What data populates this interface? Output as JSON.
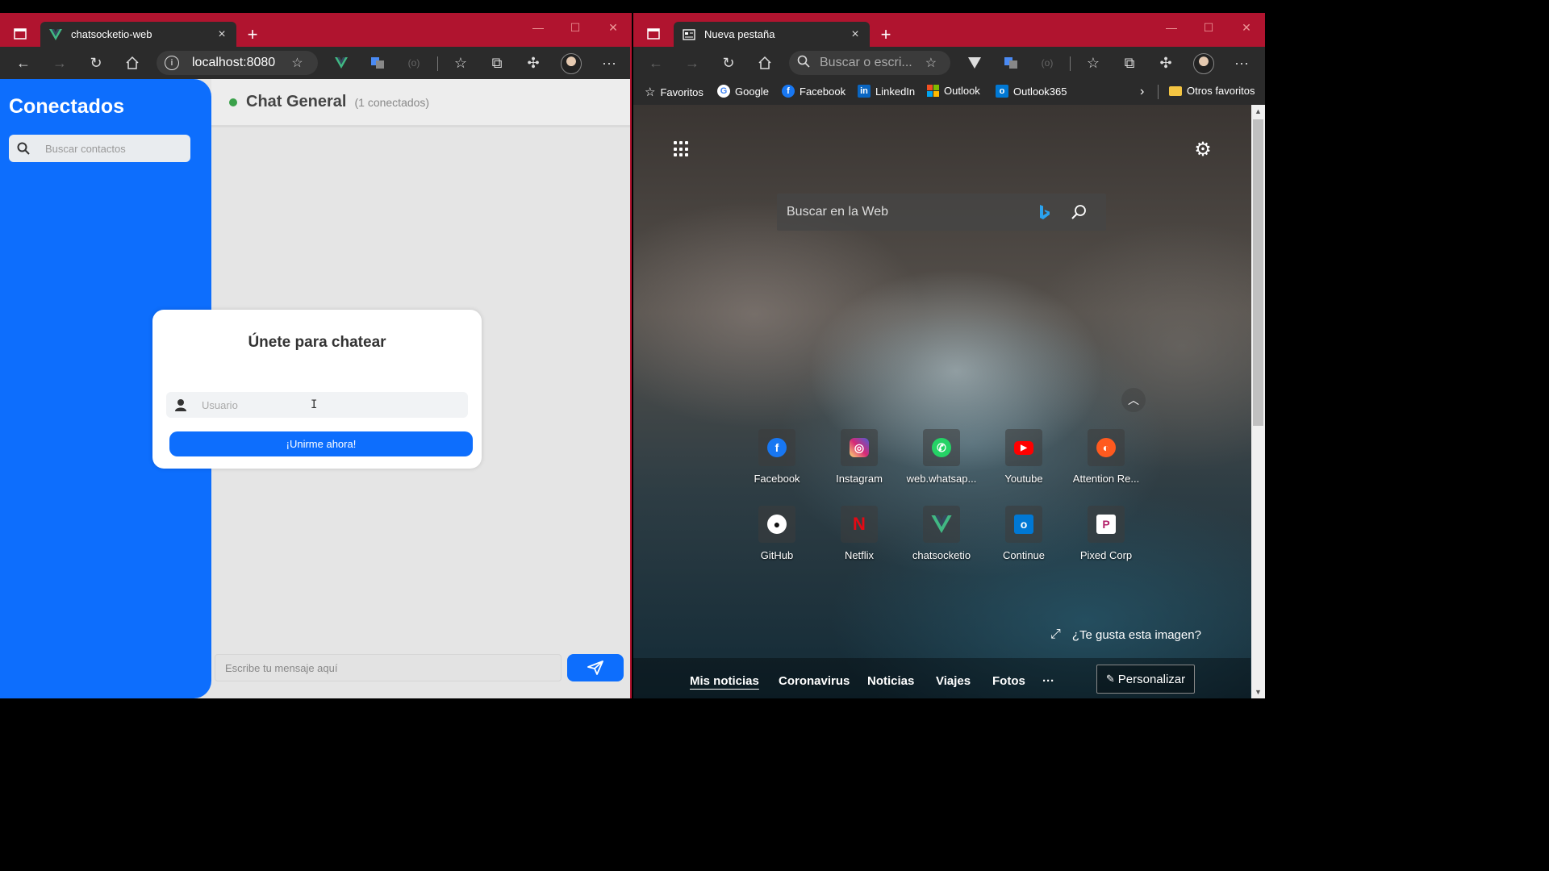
{
  "left_window": {
    "tab": {
      "title": "chatsocketio-web",
      "close": "×"
    },
    "new_tab": "+",
    "controls": {
      "minimize": "—",
      "maximize": "☐",
      "close": "✕"
    },
    "toolbar": {
      "address": "localhost:8080"
    },
    "app": {
      "sidebar_title": "Conectados",
      "contact_search_placeholder": "Buscar contactos",
      "chat_name": "Chat General",
      "chat_count": "(1 conectados)",
      "message_placeholder": "Escribe tu mensaje aquí",
      "modal": {
        "title": "Únete para chatear",
        "username_placeholder": "Usuario",
        "join_button": "¡Unirme ahora!"
      }
    }
  },
  "right_window": {
    "tab": {
      "title": "Nueva pestaña",
      "close": "×"
    },
    "new_tab": "+",
    "controls": {
      "minimize": "—",
      "maximize": "☐",
      "close": "✕"
    },
    "toolbar": {
      "address_placeholder": "Buscar o escri..."
    },
    "favorites_bar": {
      "items": [
        "Favoritos",
        "Google",
        "Facebook",
        "LinkedIn",
        "Outlook",
        "Outlook365"
      ],
      "more": "›",
      "other_favorites": "Otros favoritos"
    },
    "new_tab_page": {
      "search_placeholder": "Buscar en la Web",
      "tiles": [
        {
          "label": "Facebook",
          "icon": "facebook-icon",
          "color": "#1877f2"
        },
        {
          "label": "Instagram",
          "icon": "instagram-icon",
          "color": "#d62976"
        },
        {
          "label": "web.whatsap...",
          "icon": "whatsapp-icon",
          "color": "#25d366"
        },
        {
          "label": "Youtube",
          "icon": "youtube-icon",
          "color": "#ff0000"
        },
        {
          "label": "Attention Re...",
          "icon": "attention-icon",
          "color": "#ff5a1f"
        },
        {
          "label": "GitHub",
          "icon": "github-icon",
          "color": "#111111"
        },
        {
          "label": "Netflix",
          "icon": "netflix-icon",
          "color": "#e50914"
        },
        {
          "label": "chatsocketio",
          "icon": "vue-icon",
          "color": "#41b883"
        },
        {
          "label": "Continue",
          "icon": "outlook-icon",
          "color": "#0078d4"
        },
        {
          "label": "Pixed Corp",
          "icon": "pixed-icon",
          "color": "#b4236b"
        }
      ],
      "like_image": "¿Te gusta esta imagen?",
      "news_tabs": [
        "Mis noticias",
        "Coronavirus",
        "Noticias",
        "Viajes",
        "Fotos"
      ],
      "news_more": "···",
      "personalize": "Personalizar"
    }
  },
  "colors": {
    "titlebar": "#b0142f",
    "toolbar": "#2b2b2b",
    "primary_blue": "#0d6efd",
    "online_green": "#3aa14a"
  }
}
